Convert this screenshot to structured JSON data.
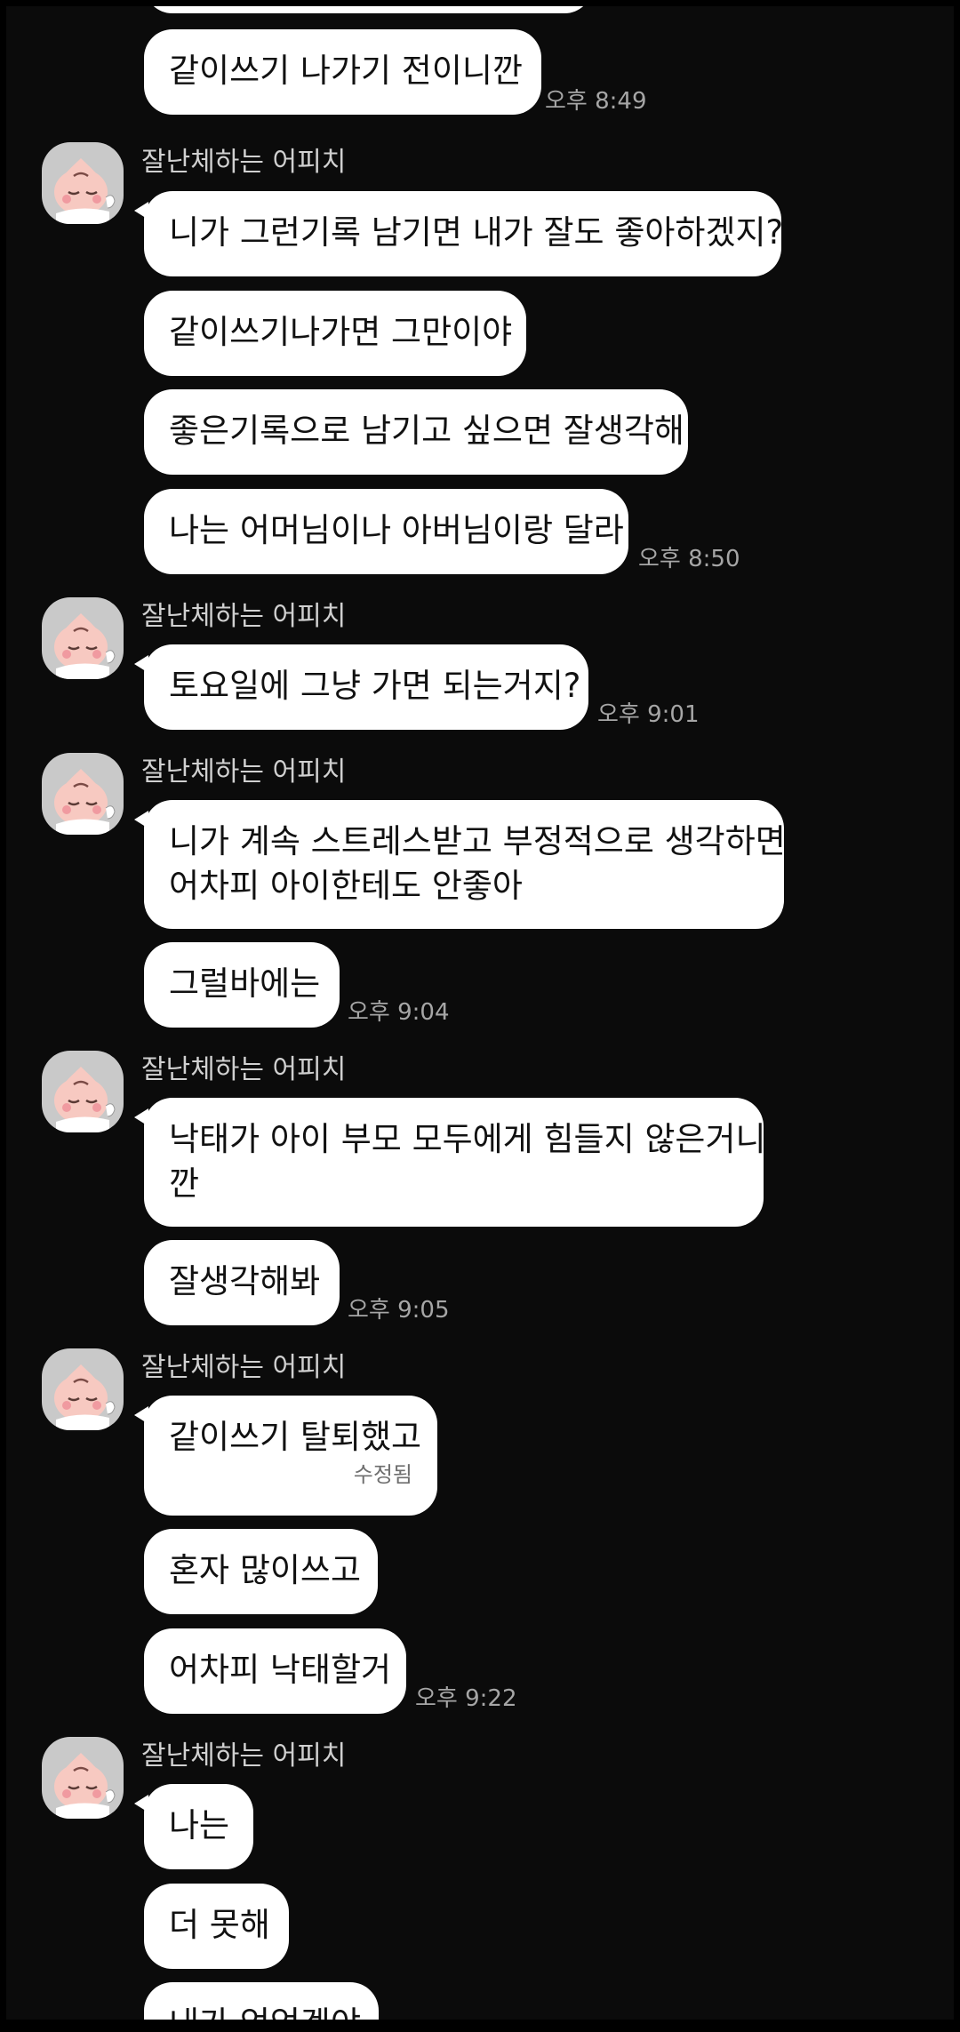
{
  "chat": {
    "top_message": {
      "text": "같이쓰기 나가기 전이니깐",
      "time": "오후 8:49"
    },
    "groups": [
      {
        "sender": "잘난체하는 어피치",
        "messages": [
          {
            "text": "니가 그런기록 남기면 내가 잘도 좋아하겠지?"
          },
          {
            "text": "같이쓰기나가면 그만이야"
          },
          {
            "text": "좋은기록으로 남기고 싶으면 잘생각해"
          },
          {
            "text": "나는 어머님이나 아버님이랑 달라",
            "time": "오후 8:50"
          }
        ]
      },
      {
        "sender": "잘난체하는 어피치",
        "messages": [
          {
            "text": "토요일에 그냥 가면 되는거지?",
            "time": "오후 9:01"
          }
        ]
      },
      {
        "sender": "잘난체하는 어피치",
        "messages": [
          {
            "line1": "니가 계속 스트레스받고 부정적으로 생각하면",
            "line2": "어차피 아이한테도 안좋아"
          },
          {
            "text": "그럴바에는",
            "time": "오후 9:04"
          }
        ]
      },
      {
        "sender": "잘난체하는 어피치",
        "messages": [
          {
            "line1": "낙태가 아이 부모 모두에게 힘들지 않은거니",
            "line2": "깐"
          },
          {
            "text": "잘생각해봐",
            "time": "오후 9:05"
          }
        ]
      },
      {
        "sender": "잘난체하는 어피치",
        "messages": [
          {
            "text": "같이쓰기 탈퇴했고",
            "edited": "수정됨"
          },
          {
            "text": "혼자 많이쓰고"
          },
          {
            "text": "어차피 낙태할거",
            "time": "오후 9:22"
          }
        ]
      },
      {
        "sender": "잘난체하는 어피치",
        "messages": [
          {
            "text": "나는"
          },
          {
            "text": "더 못해"
          },
          {
            "text": "내가 억억겠야"
          }
        ]
      }
    ]
  },
  "colors": {
    "background": "#0b0b0b",
    "bubble": "#ffffff",
    "bubble_text": "#111111",
    "sender_name": "#d0d0d0",
    "timestamp": "#a6a6a6",
    "avatar_bg": "#c9c9c9"
  },
  "icons": {
    "avatar": "apeach-profile-icon"
  }
}
